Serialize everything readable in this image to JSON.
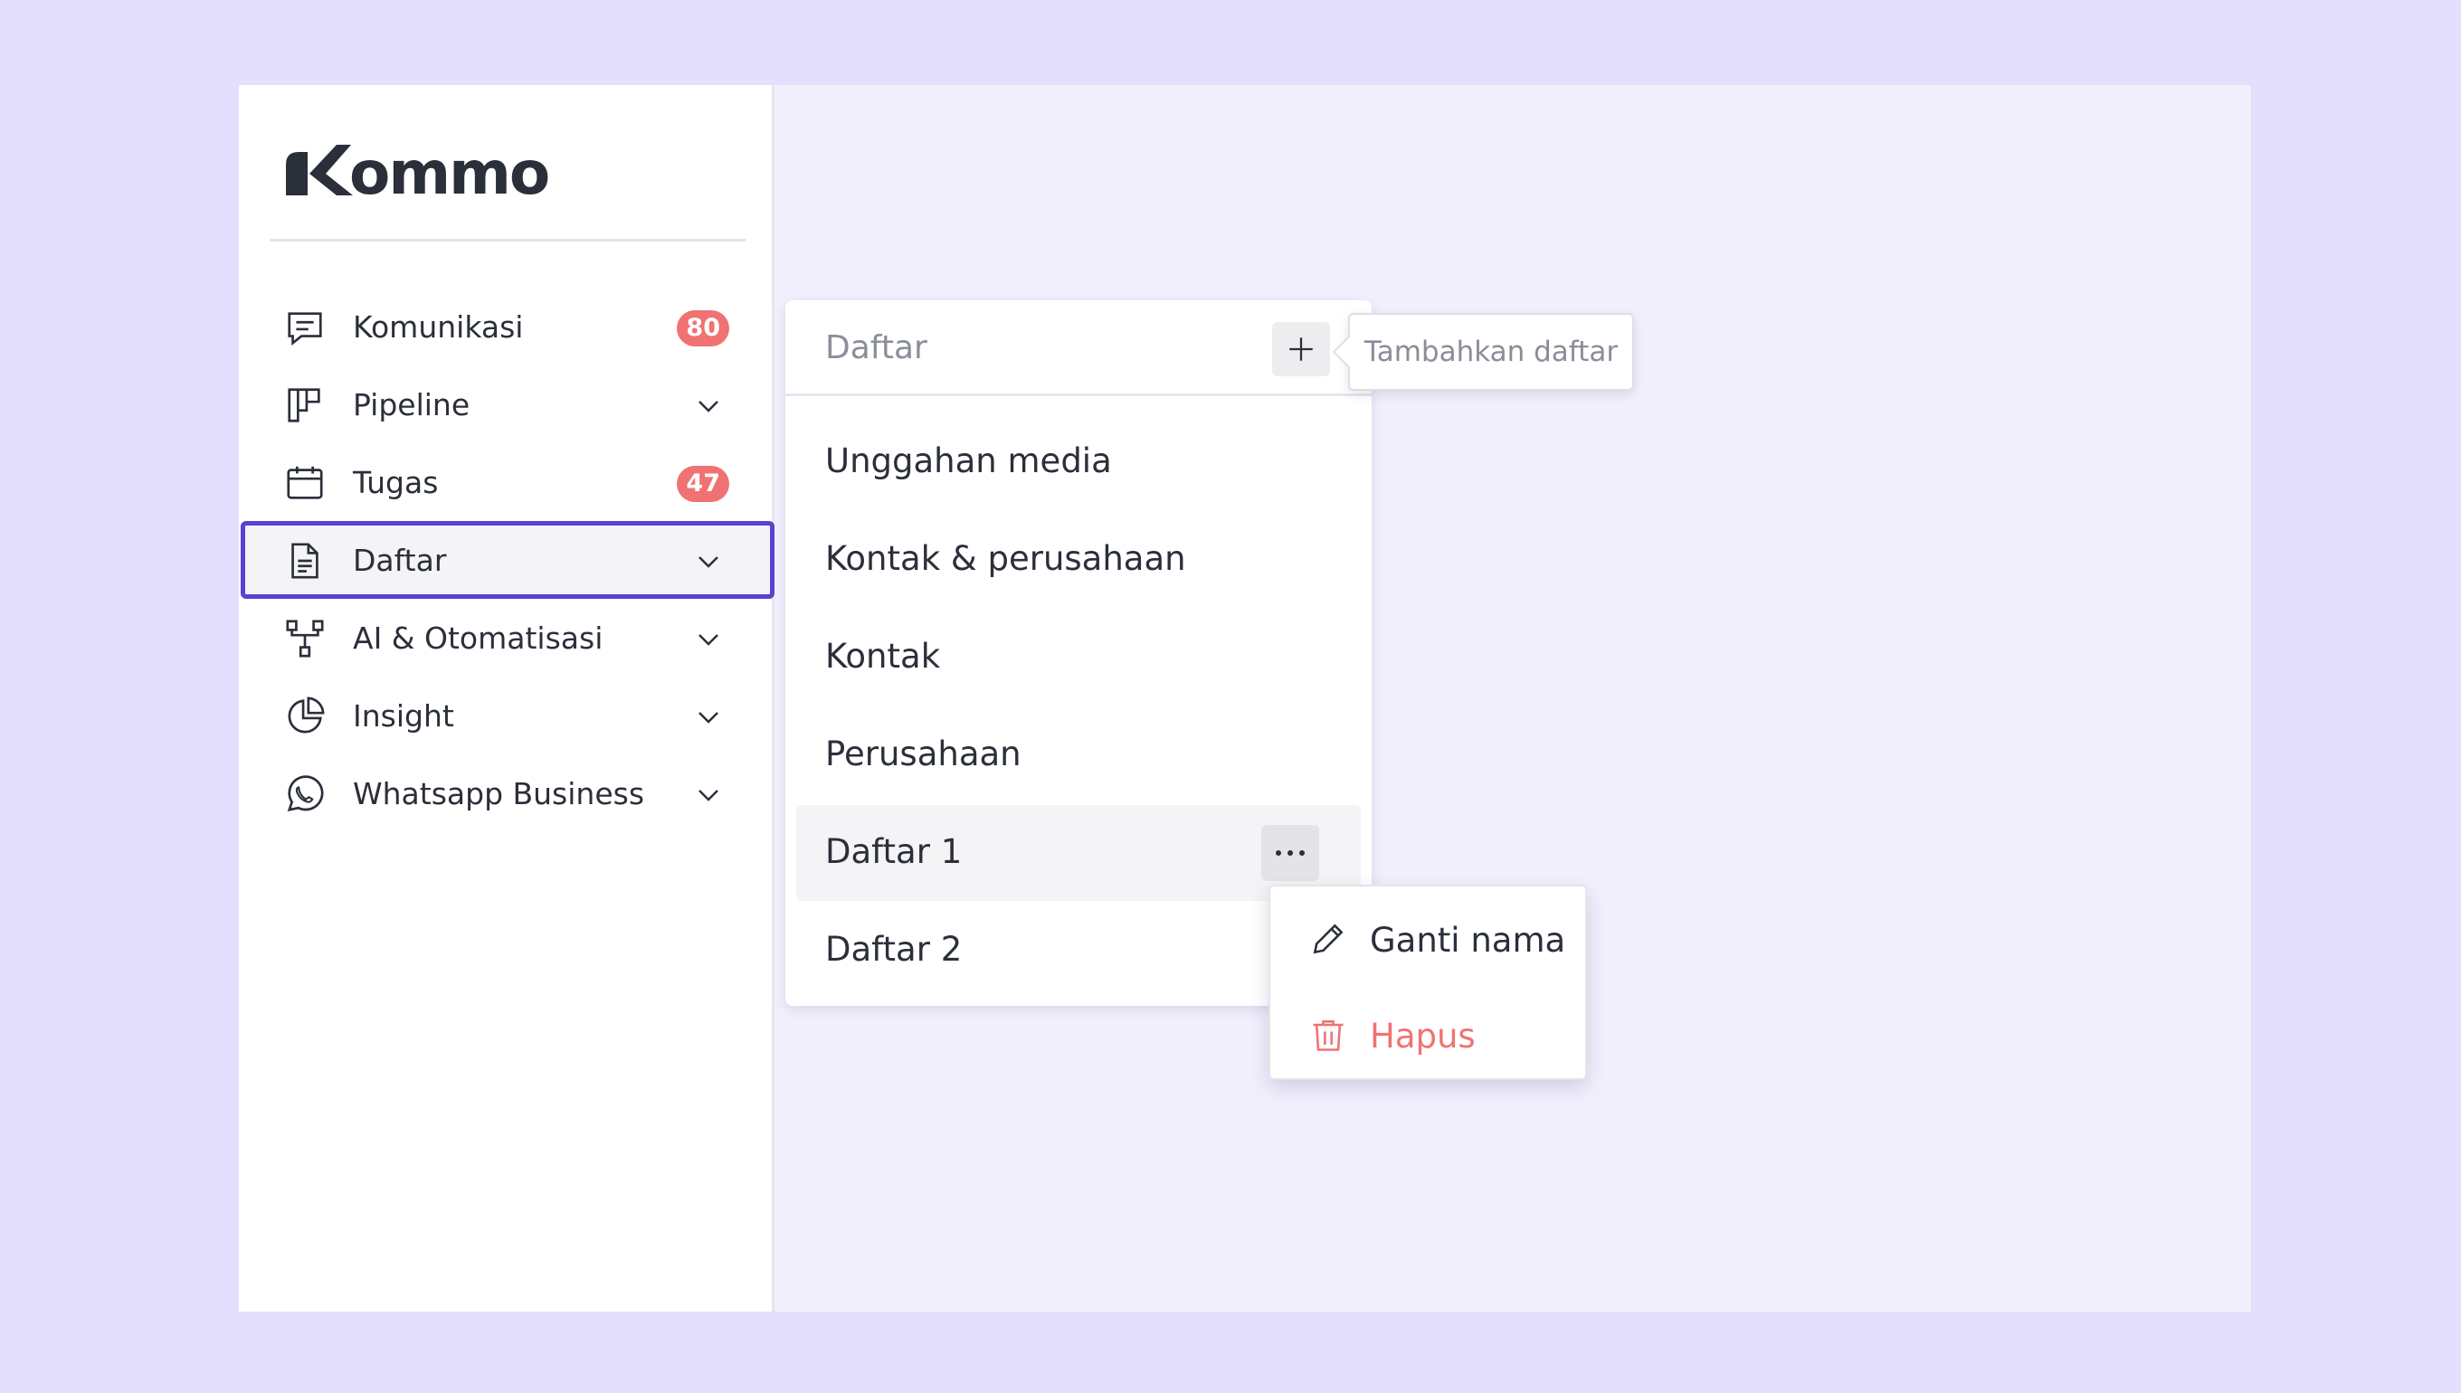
{
  "brand": {
    "logo_text": "kommo"
  },
  "sidebar": {
    "items": [
      {
        "label": "Komunikasi",
        "icon": "chat-icon",
        "badge": "80"
      },
      {
        "label": "Pipeline",
        "icon": "pipeline-icon",
        "expandable": true
      },
      {
        "label": "Tugas",
        "icon": "calendar-icon",
        "badge": "47"
      },
      {
        "label": "Daftar",
        "icon": "document-icon",
        "expandable": true,
        "active": true
      },
      {
        "label": "AI & Otomatisasi",
        "icon": "workflow-icon",
        "expandable": true
      },
      {
        "label": "Insight",
        "icon": "pie-chart-icon",
        "expandable": true
      },
      {
        "label": "Whatsapp Business",
        "icon": "whatsapp-icon",
        "expandable": true
      }
    ]
  },
  "list_panel": {
    "title": "Daftar",
    "add_tooltip": "Tambahkan daftar",
    "items": [
      {
        "label": "Unggahan media"
      },
      {
        "label": "Kontak & perusahaan"
      },
      {
        "label": "Kontak"
      },
      {
        "label": "Perusahaan"
      },
      {
        "label": "Daftar 1",
        "hovered": true
      },
      {
        "label": "Daftar 2"
      }
    ]
  },
  "context_menu": {
    "rename_label": "Ganti nama",
    "delete_label": "Hapus",
    "delete_color": "#f07272"
  },
  "colors": {
    "accent": "#5b40d6",
    "badge": "#f07272",
    "background": "#e3dffd"
  }
}
